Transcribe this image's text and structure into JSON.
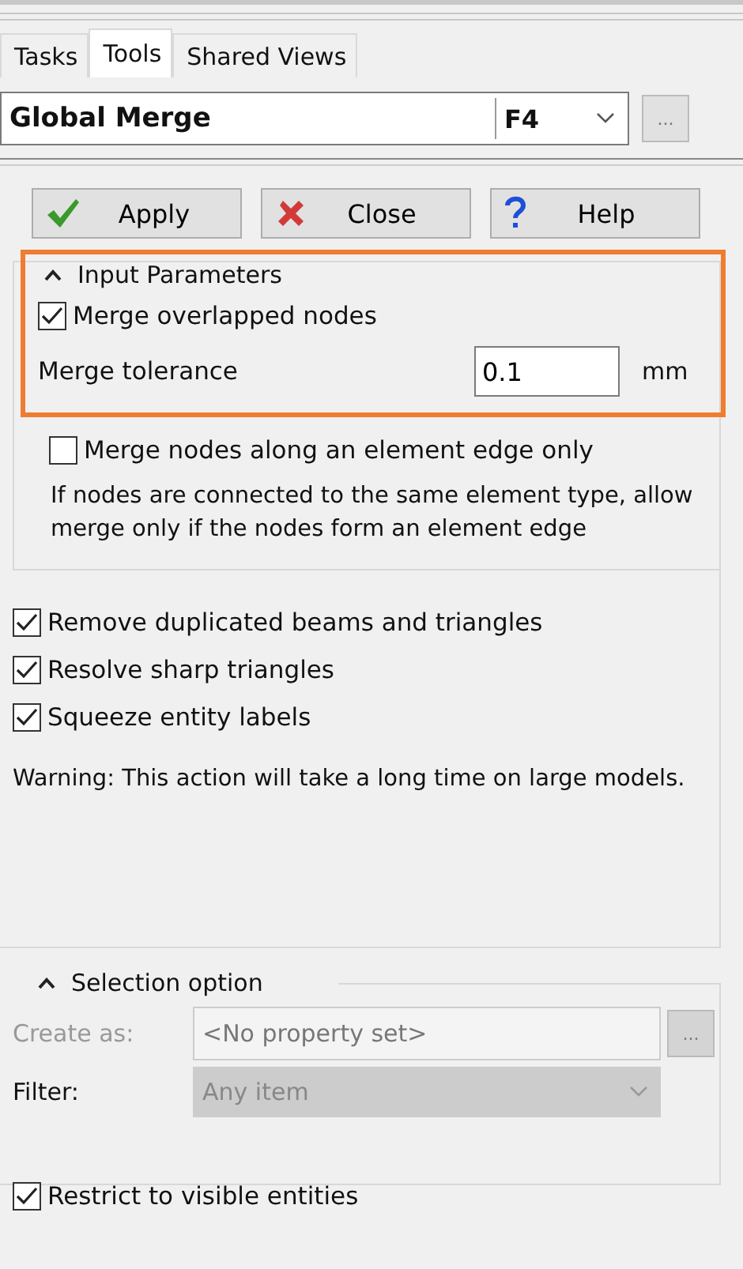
{
  "tabs": [
    {
      "label": "Tasks",
      "selected": false
    },
    {
      "label": "Tools",
      "selected": true
    },
    {
      "label": "Shared Views",
      "selected": false
    }
  ],
  "tool": {
    "name": "Global Merge",
    "shortcut": "F4",
    "more": "..."
  },
  "buttons": [
    {
      "kind": "apply",
      "label": "Apply"
    },
    {
      "kind": "close",
      "label": "Close"
    },
    {
      "kind": "help",
      "label": "Help"
    }
  ],
  "input_parameters": {
    "title": "Input Parameters",
    "expanded": true,
    "merge_overlapped": {
      "label": "Merge overlapped nodes",
      "checked": true
    },
    "tolerance": {
      "label": "Merge tolerance",
      "value": "0.1",
      "unit": "mm"
    },
    "edge_only": {
      "label": "Merge nodes along an element edge only",
      "checked": false
    },
    "description": "If nodes are connected to the same element type, allow merge only if the nodes form an element edge"
  },
  "options": [
    {
      "label": "Remove duplicated beams and triangles",
      "checked": true
    },
    {
      "label": "Resolve sharp triangles",
      "checked": true
    },
    {
      "label": "Squeeze entity labels",
      "checked": true
    }
  ],
  "warning": "Warning: This action will take a long time on large models.",
  "selection_option": {
    "title": "Selection option",
    "expanded": true,
    "create_as": {
      "label": "Create as:",
      "value": "<No property set>",
      "more": "..."
    },
    "filter": {
      "label": "Filter:",
      "value": "Any item"
    },
    "restrict": {
      "label": "Restrict to visible entities",
      "checked": true
    }
  }
}
